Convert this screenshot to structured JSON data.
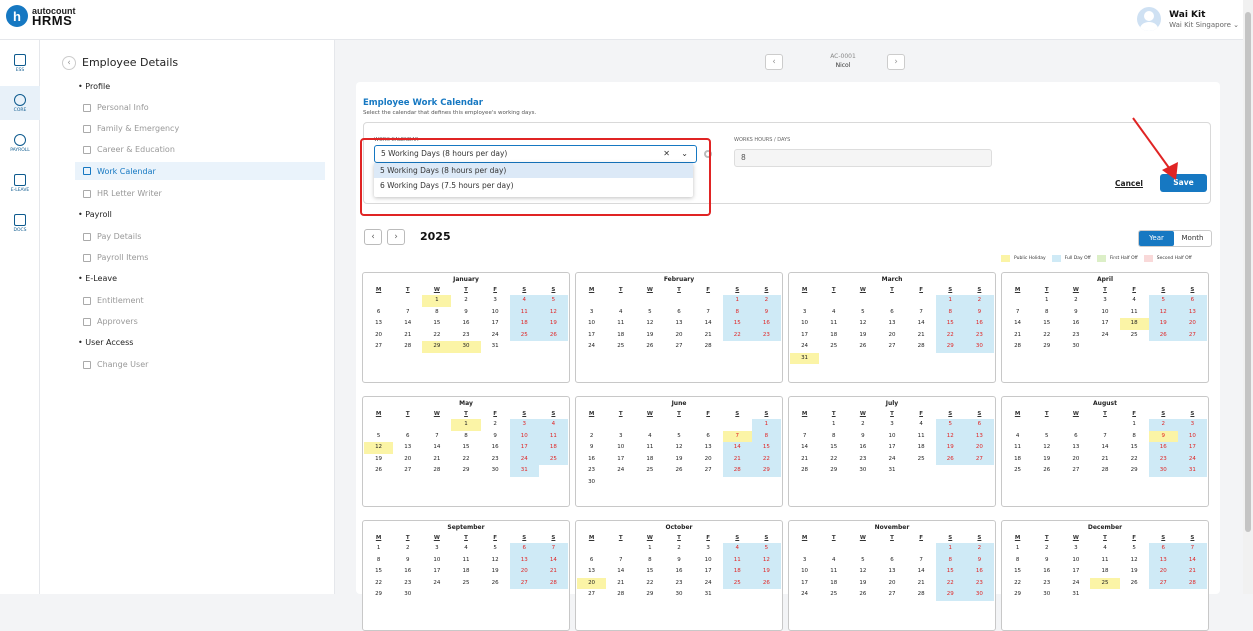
{
  "app": {
    "logo_small": "autocount",
    "logo_big": "HRMS",
    "logo_letter": "h"
  },
  "user": {
    "name": "Wai Kit",
    "org": "Wai Kit Singapore ⌄"
  },
  "sidenav": [
    {
      "label": "ESS"
    },
    {
      "label": "CORE"
    },
    {
      "label": "PAYROLL"
    },
    {
      "label": "E-LEAVE"
    },
    {
      "label": "DOCS"
    }
  ],
  "subnav": {
    "title": "Employee Details",
    "groups": [
      {
        "label": "Profile",
        "items": [
          "Personal Info",
          "Family & Emergency",
          "Career & Education",
          "Work Calendar",
          "HR Letter Writer"
        ]
      },
      {
        "label": "Payroll",
        "items": [
          "Pay Details",
          "Payroll Items"
        ]
      },
      {
        "label": "E-Leave",
        "items": [
          "Entitlement",
          "Approvers"
        ]
      },
      {
        "label": "User Access",
        "items": [
          "Change User"
        ]
      }
    ]
  },
  "employee": {
    "id": "AC-0001",
    "name": "Nicol"
  },
  "form": {
    "title": "Employee Work Calendar",
    "subtitle": "Select the calendar that defines this employee's working days.",
    "calendar_label": "WORK CALENDAR",
    "calendar_value": "5 Working Days (8 hours per day)",
    "options": [
      "5 Working Days (8 hours per day)",
      "6 Working Days (7.5 hours per day)"
    ],
    "hours_label": "WORKS HOURS / DAYS",
    "hours_value": "8",
    "cancel": "Cancel",
    "save": "Save"
  },
  "calendar": {
    "year": "2025",
    "view_year": "Year",
    "view_month": "Month",
    "legend": [
      {
        "label": "Public Holiday",
        "color": "#fbf4a6"
      },
      {
        "label": "Full Day Off",
        "color": "#cfeaf6"
      },
      {
        "label": "First Half Off",
        "color": "#dcefc7"
      },
      {
        "label": "Second Half Off",
        "color": "#f9d9d9"
      }
    ],
    "weekdays": [
      "M",
      "T",
      "W",
      "T",
      "F",
      "S",
      "S"
    ],
    "months": [
      {
        "name": "January",
        "offset": 2,
        "days": 31,
        "holidays": [
          1,
          29,
          30
        ]
      },
      {
        "name": "February",
        "offset": 5,
        "days": 28,
        "holidays": []
      },
      {
        "name": "March",
        "offset": 5,
        "days": 31,
        "holidays": [
          31
        ]
      },
      {
        "name": "April",
        "offset": 1,
        "days": 30,
        "holidays": [
          18
        ]
      },
      {
        "name": "May",
        "offset": 3,
        "days": 31,
        "holidays": [
          1,
          12
        ]
      },
      {
        "name": "June",
        "offset": 6,
        "days": 30,
        "holidays": [
          7
        ]
      },
      {
        "name": "July",
        "offset": 1,
        "days": 31,
        "holidays": []
      },
      {
        "name": "August",
        "offset": 4,
        "days": 31,
        "holidays": [
          9
        ]
      },
      {
        "name": "September",
        "offset": 0,
        "days": 30,
        "holidays": []
      },
      {
        "name": "October",
        "offset": 2,
        "days": 31,
        "holidays": [
          20
        ]
      },
      {
        "name": "November",
        "offset": 5,
        "days": 30,
        "holidays": []
      },
      {
        "name": "December",
        "offset": 0,
        "days": 31,
        "holidays": [
          25
        ]
      }
    ]
  }
}
